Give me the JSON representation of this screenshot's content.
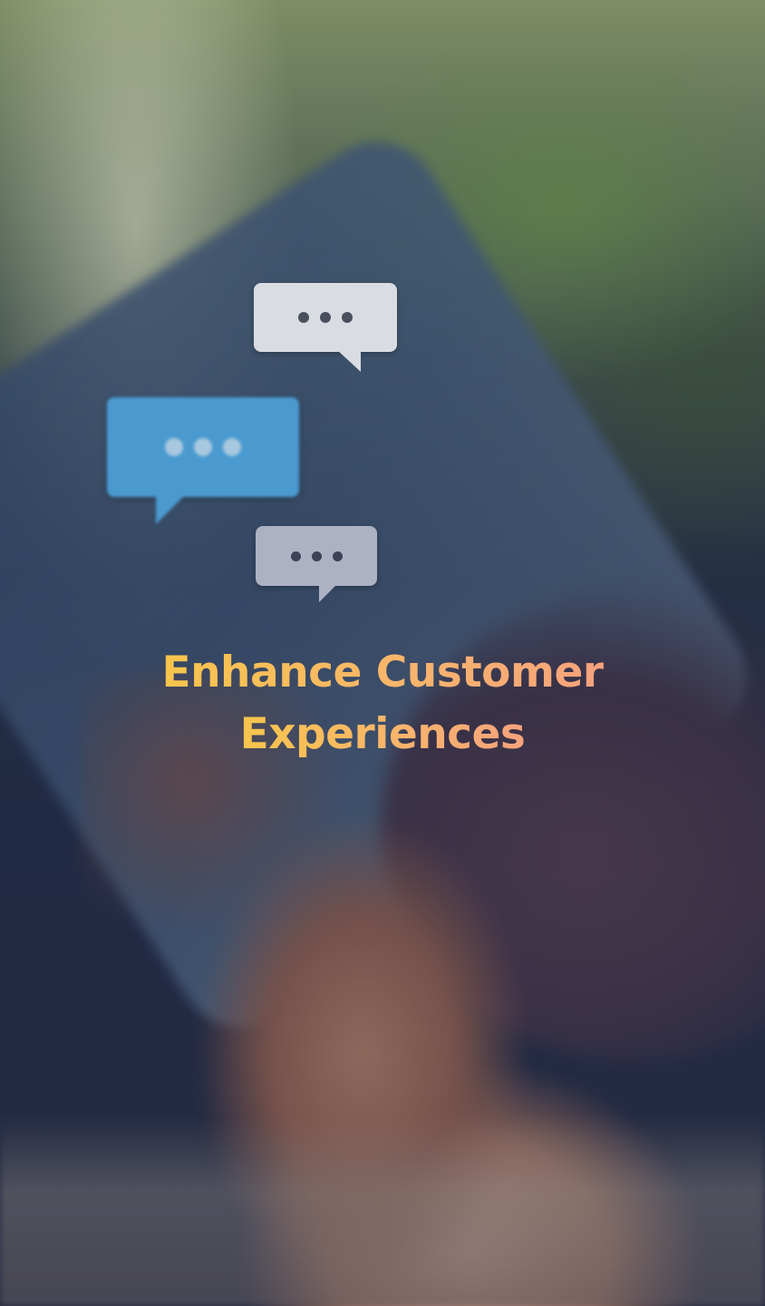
{
  "headline": {
    "line1": "Enhance Customer",
    "line2": "Experiences"
  },
  "colors": {
    "headline_gradient_start": "#f7c54c",
    "headline_gradient_end": "#f5a27c",
    "overlay_tint": "#1c2640"
  },
  "image": {
    "subject": "background-photo"
  }
}
